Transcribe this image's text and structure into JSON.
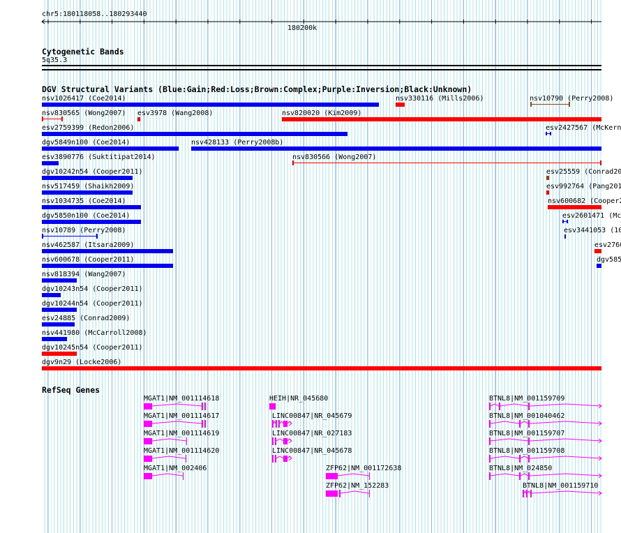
{
  "ruler": {
    "range": "chr5:180118058..180293440",
    "tick_label": "180200k"
  },
  "tracks": {
    "cyto": {
      "title": "Cytogenetic Bands",
      "band": "5q35.3"
    },
    "dgv": {
      "title": "DGV Structural Variants (Blue:Gain;Red:Loss;Brown:Complex;Purple:Inversion;Black:Unknown)",
      "features": [
        {
          "label": "nsv1026417 (Coe2014)",
          "type": "gain"
        },
        {
          "label": "nsv330116 (Mills2006)",
          "type": "loss"
        },
        {
          "label": "nsv10790 (Perry2008)",
          "type": "complex"
        },
        {
          "label": "nsv830565 (Wong2007)",
          "type": "loss"
        },
        {
          "label": "esv3978 (Wang2008)",
          "type": "loss"
        },
        {
          "label": "nsv820020 (Kim2009)",
          "type": "loss"
        },
        {
          "label": "esv2427567 (McKern",
          "type": "gain"
        },
        {
          "label": "esv2759399 (Redon2006)",
          "type": "gain"
        },
        {
          "label": "dgv5849n100 (Coe2014)",
          "type": "gain"
        },
        {
          "label": "nsv428133 (Perry2008b)",
          "type": "gain"
        },
        {
          "label": "esv3890776 (Suktitipat2014)",
          "type": "gain"
        },
        {
          "label": "nsv830566 (Wong2007)",
          "type": "loss"
        },
        {
          "label": "dgv10242n54 (Cooper2011)",
          "type": "gain"
        },
        {
          "label": "esv25559 (Conrad20",
          "type": "complex"
        },
        {
          "label": "nsv517459 (Shaikh2009)",
          "type": "gain"
        },
        {
          "label": "esv992764 (Pang201",
          "type": "loss"
        },
        {
          "label": "nsv1034735 (Coe2014)",
          "type": "gain"
        },
        {
          "label": "nsv600682 (Cooper2",
          "type": "loss"
        },
        {
          "label": "dgv5850n100 (Coe2014)",
          "type": "gain"
        },
        {
          "label": "esv2601471 (Mc",
          "type": "gain"
        },
        {
          "label": "nsv10789 (Perry2008)",
          "type": "gain"
        },
        {
          "label": "esv3441053 (10",
          "type": "gain"
        },
        {
          "label": "nsv462587 (Itsara2009)",
          "type": "gain"
        },
        {
          "label": "esv2760",
          "type": "loss"
        },
        {
          "label": "nsv600678 (Cooper2011)",
          "type": "gain"
        },
        {
          "label": "dgv585",
          "type": "gain"
        },
        {
          "label": "nsv818394 (Wang2007)",
          "type": "gain"
        },
        {
          "label": "dgv10243n54 (Cooper2011)",
          "type": "gain"
        },
        {
          "label": "dgv10244n54 (Cooper2011)",
          "type": "gain"
        },
        {
          "label": "esv24885 (Conrad2009)",
          "type": "gain"
        },
        {
          "label": "nsv441980 (McCarroll2008)",
          "type": "gain"
        },
        {
          "label": "dgv10245n54 (Cooper2011)",
          "type": "loss"
        },
        {
          "label": "dgv9n29 (Locke2006)",
          "type": "loss"
        }
      ]
    },
    "refseq": {
      "title": "RefSeq Genes",
      "genes": [
        {
          "label": "MGAT1|NM_001114618"
        },
        {
          "label": "HEIH|NR_045680"
        },
        {
          "label": "BTNL8|NM_001159709"
        },
        {
          "label": "MGAT1|NM_001114617"
        },
        {
          "label": "LINC00847|NR_045679"
        },
        {
          "label": "BTNL8|NM_001040462"
        },
        {
          "label": "MGAT1|NM_001114619"
        },
        {
          "label": "LINC00847|NR_027183"
        },
        {
          "label": "BTNL8|NM_001159707"
        },
        {
          "label": "MGAT1|NM_001114620"
        },
        {
          "label": "LINC00847|NR_045678"
        },
        {
          "label": "BTNL8|NM_001159708"
        },
        {
          "label": "MGAT1|NM_002406"
        },
        {
          "label": "ZFP62|NM_001172638"
        },
        {
          "label": "BTNL8|NM_024850"
        },
        {
          "label": "ZFP62|NM_152283"
        },
        {
          "label": "BTNL8|NM_001159710"
        }
      ]
    }
  },
  "colors": {
    "gain": "#0000ee",
    "loss": "#ff0000",
    "complex": "#8b4513",
    "gene": "#ff00ff",
    "grid_minor": "#a8e8ee",
    "grid_major": "#88b8ee"
  }
}
